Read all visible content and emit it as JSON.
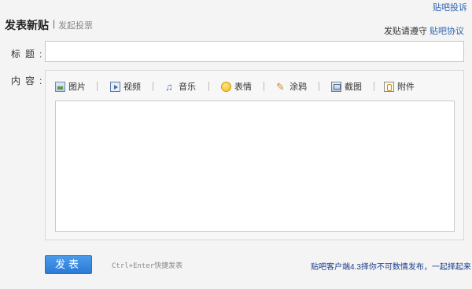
{
  "top": {
    "complaint_link": "贴吧投诉"
  },
  "header": {
    "title": "发表新贴",
    "separator": "|",
    "vote_link": "发起投票",
    "agreement_prefix": "发贴请遵守 ",
    "agreement_link": "贴吧协议"
  },
  "form": {
    "title_label": "标题:",
    "title_value": "",
    "content_label": "内容:",
    "content_value": ""
  },
  "toolbar": {
    "items": [
      {
        "label": "图片",
        "icon": "image-icon"
      },
      {
        "label": "视频",
        "icon": "video-icon"
      },
      {
        "label": "音乐",
        "icon": "music-icon"
      },
      {
        "label": "表情",
        "icon": "smiley-icon"
      },
      {
        "label": "涂鸦",
        "icon": "brush-icon"
      },
      {
        "label": "截图",
        "icon": "screenshot-icon"
      },
      {
        "label": "附件",
        "icon": "attachment-icon"
      }
    ]
  },
  "footer": {
    "submit_label": "发表",
    "shortcut_hint": "Ctrl+Enter快捷发表",
    "promo_text": "贴吧客户端4.3择你不可数情发布，一起择起来"
  },
  "colors": {
    "background": "#f4f4f4",
    "link": "#2d64b3",
    "button": "#2a7ad8",
    "promo": "#1a3d8a"
  }
}
